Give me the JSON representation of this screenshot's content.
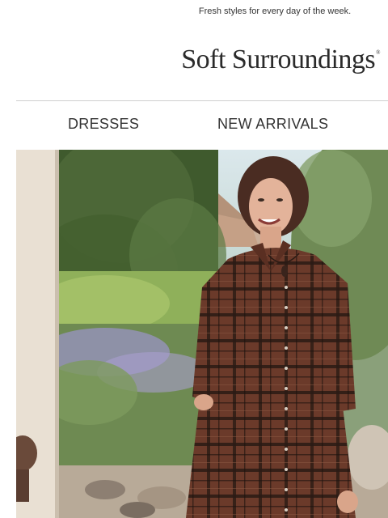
{
  "preheader": {
    "text": "Fresh styles for every day of the week."
  },
  "brand": {
    "name": "Soft Surroundings",
    "trademark": "®"
  },
  "nav": {
    "items": [
      {
        "label": "DRESSES"
      },
      {
        "label": "NEW ARRIVALS"
      }
    ]
  },
  "hero": {
    "subject": "woman in plaid shirtdress in garden",
    "colors": {
      "dress": "#6b3a2a",
      "plaid_dark": "#2a1a14",
      "hedge": "#4f6a3a",
      "sky": "#cfe0e6",
      "lavender": "#9a93c4"
    }
  }
}
